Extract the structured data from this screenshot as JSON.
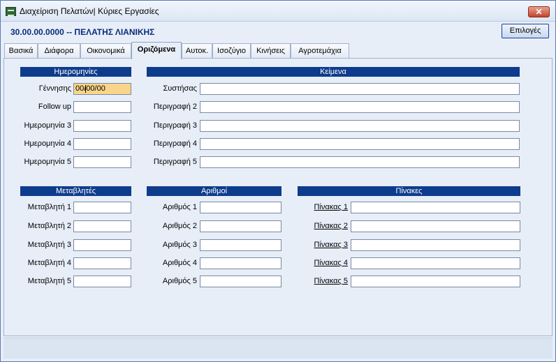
{
  "window": {
    "title": "Διαχείριση Πελατών| Κύριες Εργασίες",
    "close_glyph": "✕"
  },
  "header": {
    "customer": "30.00.00.0000 -- ΠΕΛΑΤΗΣ ΛΙΑΝΙΚΗΣ",
    "options_label": "Επιλογές"
  },
  "tabs": [
    {
      "label": "Βασικά"
    },
    {
      "label": "Διάφορα"
    },
    {
      "label": "Οικονομικά"
    },
    {
      "label": "Οριζόμενα",
      "active": true
    },
    {
      "label": "Αυτοκ."
    },
    {
      "label": "Ισοζύγιο"
    },
    {
      "label": "Κινήσεις"
    },
    {
      "label": "Αγροτεμάχια"
    }
  ],
  "dates": {
    "header": "Ημερομηνίες",
    "fields": [
      {
        "label": "Γέννησης",
        "value": "00/00/00"
      },
      {
        "label": "Follow up",
        "value": ""
      },
      {
        "label": "Ημερομηνία 3",
        "value": ""
      },
      {
        "label": "Ημερομηνία 4",
        "value": ""
      },
      {
        "label": "Ημερομηνία 5",
        "value": ""
      }
    ]
  },
  "texts": {
    "header": "Κείμενα",
    "fields": [
      {
        "label": "Συστήσας",
        "value": ""
      },
      {
        "label": "Περιγραφή 2",
        "value": ""
      },
      {
        "label": "Περιγραφή 3",
        "value": ""
      },
      {
        "label": "Περιγραφή 4",
        "value": ""
      },
      {
        "label": "Περιγραφή 5",
        "value": ""
      }
    ]
  },
  "variables": {
    "header": "Μεταβλητές",
    "fields": [
      {
        "label": "Μεταβλητή 1",
        "value": ""
      },
      {
        "label": "Μεταβλητή 2",
        "value": ""
      },
      {
        "label": "Μεταβλητή 3",
        "value": ""
      },
      {
        "label": "Μεταβλητή 4",
        "value": ""
      },
      {
        "label": "Μεταβλητή 5",
        "value": ""
      }
    ]
  },
  "numbers": {
    "header": "Αριθμοί",
    "fields": [
      {
        "label": "Αριθμός 1",
        "value": ""
      },
      {
        "label": "Αριθμός 2",
        "value": ""
      },
      {
        "label": "Αριθμός 3",
        "value": ""
      },
      {
        "label": "Αριθμός 4",
        "value": ""
      },
      {
        "label": "Αριθμός 5",
        "value": ""
      }
    ]
  },
  "tables": {
    "header": "Πίνακες",
    "fields": [
      {
        "label": "Πίνακας 1",
        "value": ""
      },
      {
        "label": "Πίνακας 2",
        "value": ""
      },
      {
        "label": "Πίνακας 3",
        "value": ""
      },
      {
        "label": "Πίνακας 4",
        "value": ""
      },
      {
        "label": "Πίνακας 5",
        "value": ""
      }
    ]
  }
}
